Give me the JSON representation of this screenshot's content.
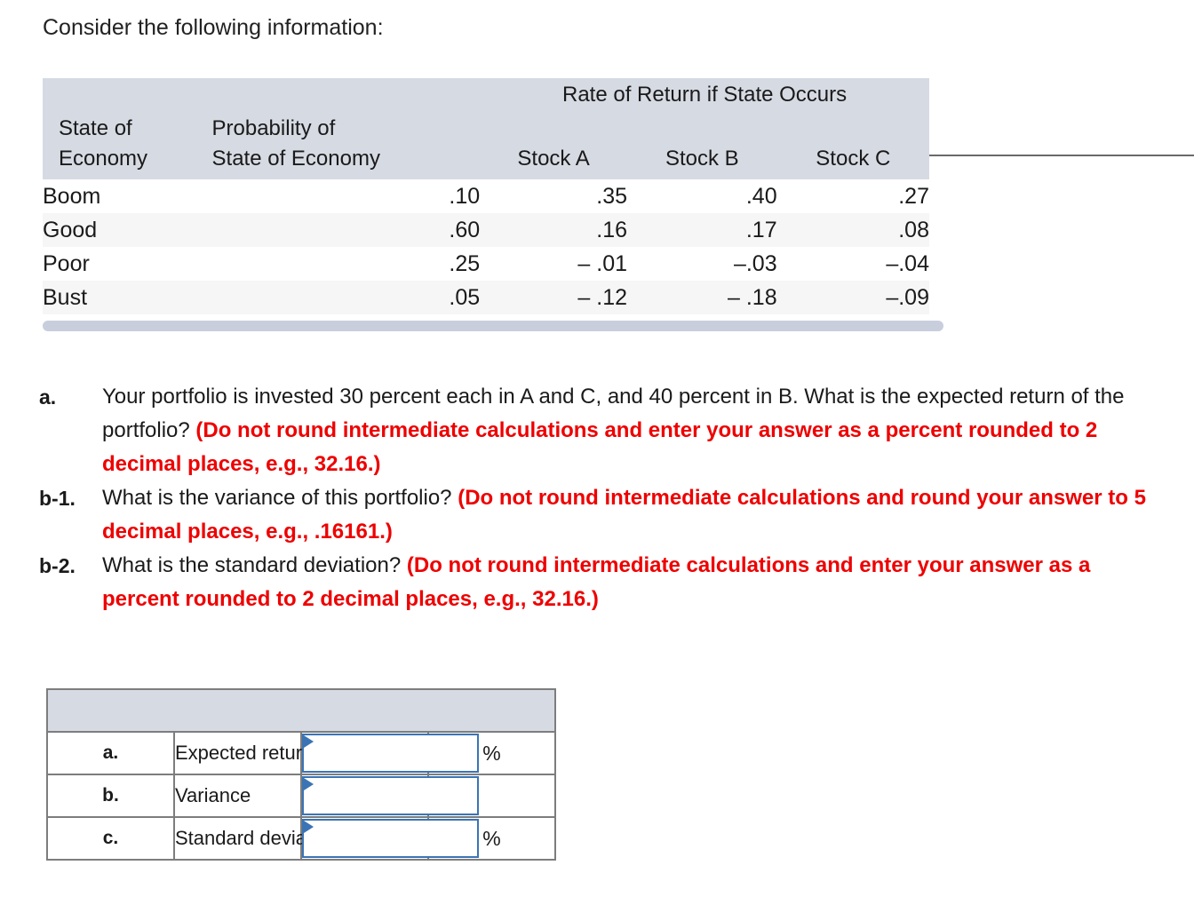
{
  "intro": "Consider the following information:",
  "data_table": {
    "super_header": "Rate of Return if State Occurs",
    "headers": {
      "state_line1": "State of",
      "state_line2": "Economy",
      "prob_line1": "Probability of",
      "prob_line2": "State of Economy",
      "stock_a": "Stock A",
      "stock_b": "Stock B",
      "stock_c": "Stock C"
    },
    "rows": [
      {
        "state": "Boom",
        "probability": ".10",
        "stock_a": ".35",
        "stock_b": ".40",
        "stock_c": ".27"
      },
      {
        "state": "Good",
        "probability": ".60",
        "stock_a": ".16",
        "stock_b": ".17",
        "stock_c": ".08"
      },
      {
        "state": "Poor",
        "probability": ".25",
        "stock_a": "– .01",
        "stock_b": "–.03",
        "stock_c": "–.04"
      },
      {
        "state": "Bust",
        "probability": ".05",
        "stock_a": "– .12",
        "stock_b": "– .18",
        "stock_c": "–.09"
      }
    ]
  },
  "questions": [
    {
      "label": "a.",
      "text_black_1": "Your portfolio is invested 30 percent each in A and C, and 40 percent in B. What is the expected return of the portfolio? ",
      "text_red": "(Do not round intermediate calculations and enter your answer as a percent rounded to 2 decimal places, e.g., 32.16.)"
    },
    {
      "label": "b-1.",
      "text_black_1": "What is the variance of this portfolio? ",
      "text_red": "(Do not round intermediate calculations and round your answer to 5 decimal places, e.g., .16161.)"
    },
    {
      "label": "b-2.",
      "text_black_1": "What is the standard deviation? ",
      "text_red": "(Do not round intermediate calculations and enter your answer as a percent rounded to 2 decimal places, e.g., 32.16.)"
    }
  ],
  "answer_table": {
    "rows": [
      {
        "letter": "a.",
        "label": "Expected return",
        "value": "",
        "unit": "%"
      },
      {
        "letter": "b.",
        "label": "Variance",
        "value": "",
        "unit": ""
      },
      {
        "letter": "c.",
        "label": "Standard deviation",
        "value": "",
        "unit": "%"
      }
    ]
  },
  "colors": {
    "header_bg": "#d6dae3",
    "alt_row_bg": "#f6f6f6",
    "emphasis_red": "#ee0000",
    "input_border": "#3b74b5",
    "table_border": "#7d7d7d",
    "separator_bar": "#c8cedc"
  }
}
